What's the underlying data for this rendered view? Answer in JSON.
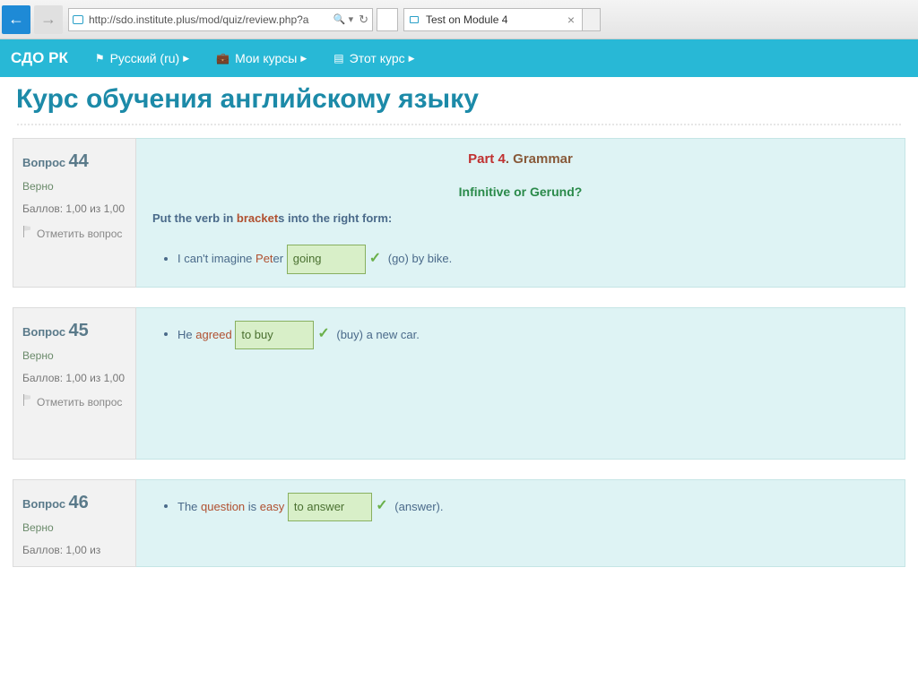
{
  "browser": {
    "url": "http://sdo.institute.plus/mod/quiz/review.php?a",
    "tab_title": "Test on Module 4"
  },
  "nav": {
    "brand": "СДО РК",
    "lang": "Русский (ru)",
    "my_courses": "Мои курсы",
    "this_course": "Этот курс"
  },
  "heading": "Курс обучения английскому языку",
  "labels": {
    "question": "Вопрос",
    "correct": "Верно",
    "score": "Баллов: 1,00 из 1,00",
    "score_partial": "Баллов: 1,00 из",
    "flag": "Отметить вопрос"
  },
  "q44": {
    "num": "44",
    "part_a": "Part 4",
    "part_b": ". Grammar",
    "subhead": "Infinitive or Gerund?",
    "instr_a": "Put the verb in ",
    "instr_b": "bracket",
    "instr_c": "s into the right form:",
    "s_a": "I can't imagine ",
    "s_b": "Pet",
    "s_c": "er ",
    "ans": "going",
    "hint": " (go) by bike."
  },
  "q45": {
    "num": "45",
    "s_a": "He ",
    "s_b": "agreed",
    "s_c": " ",
    "ans": "to buy",
    "hint": " (buy) a new car."
  },
  "q46": {
    "num": "46",
    "s_a": "The ",
    "s_b": "question",
    "s_c": " is ",
    "s_d": "easy",
    "s_e": " ",
    "ans": "to answer",
    "hint": " (answer)."
  }
}
